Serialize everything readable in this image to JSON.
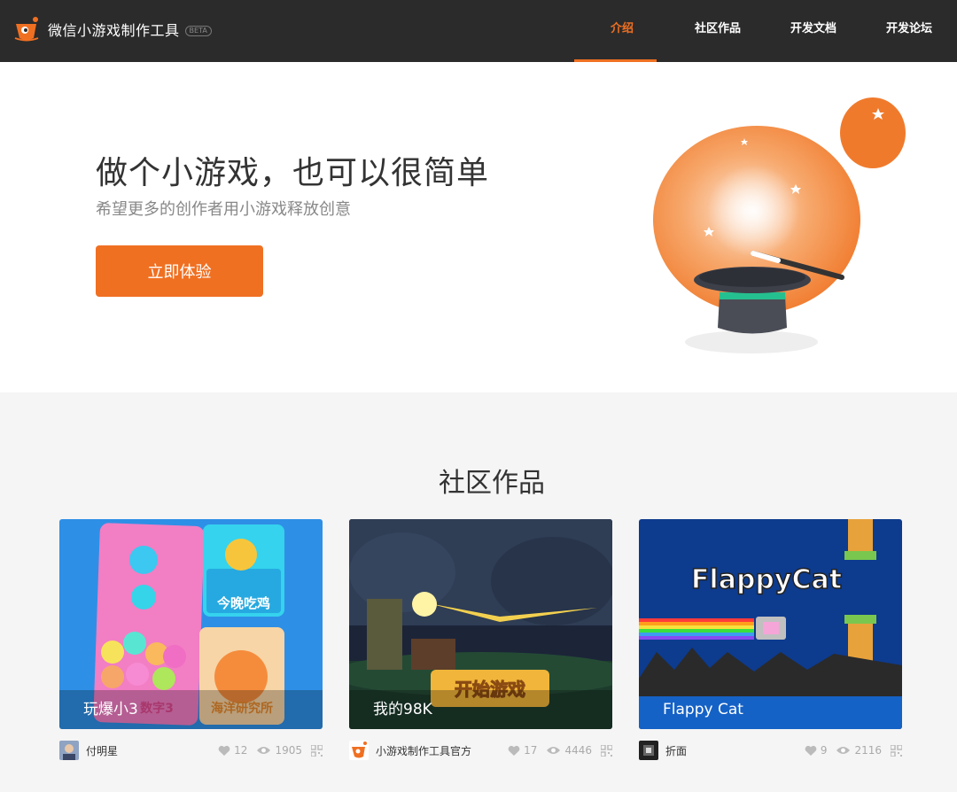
{
  "header": {
    "brand": "微信小游戏制作工具",
    "badge": "BETA",
    "nav": [
      {
        "label": "介绍",
        "active": true
      },
      {
        "label": "社区作品",
        "active": false
      },
      {
        "label": "开发文档",
        "active": false
      },
      {
        "label": "开发论坛",
        "active": false
      }
    ]
  },
  "hero": {
    "title": "做个小游戏，也可以很简单",
    "subtitle": "希望更多的创作者用小游戏释放创意",
    "cta": "立即体验"
  },
  "community": {
    "title": "社区作品",
    "works": [
      {
        "caption": "玩爆小3",
        "author": "付明星",
        "likes": "12",
        "views": "1905",
        "image_text": [
          "今晚吃鸡",
          "海洋研究所",
          "数字3"
        ]
      },
      {
        "caption": "我的98K",
        "author": "小游戏制作工具官方",
        "likes": "17",
        "views": "4446",
        "image_text": [
          "开始游戏"
        ]
      },
      {
        "caption": "Flappy Cat",
        "author": "折面",
        "likes": "9",
        "views": "2116",
        "image_text": [
          "FlappyCat"
        ]
      }
    ]
  },
  "colors": {
    "accent": "#f07022",
    "header_bg": "#2b2b2b"
  }
}
